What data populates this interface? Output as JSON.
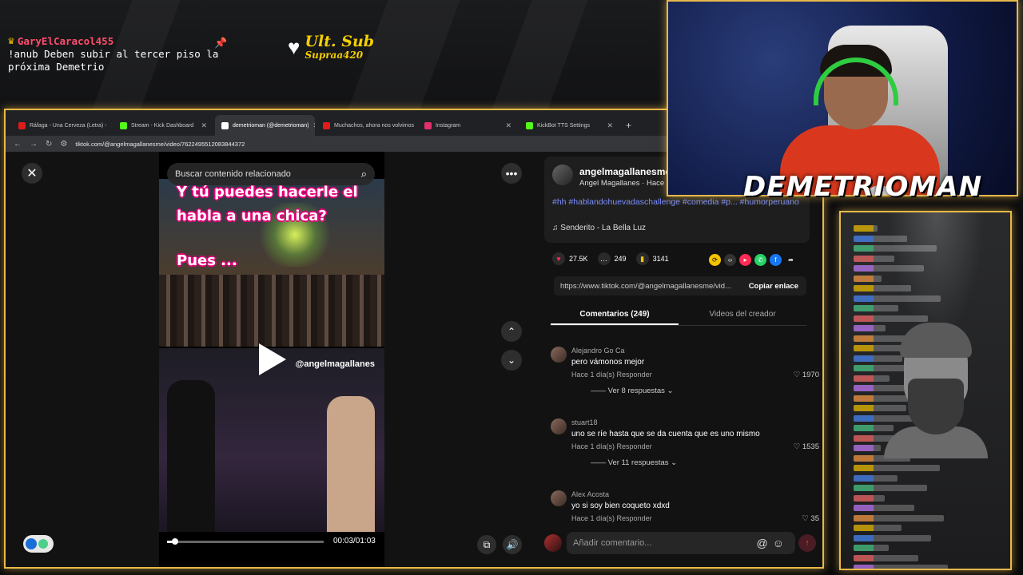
{
  "overlay": {
    "chat_user": "GaryElCaracol455",
    "chat_message": "!anub Deben subir al tercer piso la próxima Demetrio",
    "ult_sub_label": "Ult. Sub",
    "ult_sub_name": "Supraa420",
    "streamer_name": "DEMETRIOMAN"
  },
  "browser": {
    "tabs": [
      {
        "label": "Ráfaga - Una Cerveza (Letra) - ",
        "icon": "youtube-icon",
        "color": "#e01b1b",
        "active": false
      },
      {
        "label": "Stream - Kick Dashboard",
        "icon": "kick-icon",
        "color": "#53fc18",
        "active": false
      },
      {
        "label": "demetrioman (@demetrioman)",
        "icon": "tiktok-icon",
        "color": "#ffffff",
        "active": true
      },
      {
        "label": "Muchachos, ahora nos volvimos",
        "icon": "youtube-icon",
        "color": "#e01b1b",
        "active": false
      },
      {
        "label": "Instagram",
        "icon": "instagram-icon",
        "color": "#e1306c",
        "active": false
      },
      {
        "label": "KickBot TTS Settings",
        "icon": "kick-icon",
        "color": "#53fc18",
        "active": false
      }
    ],
    "url": "tiktok.com/@angelmagallanesme/video/7622495512083844372"
  },
  "video": {
    "search_placeholder": "Buscar contenido relacionado",
    "caption_line1": "Y tú puedes hacerle el",
    "caption_line2": "habla a una chica?",
    "caption_line3": "Pues ...",
    "handle": "@angelmagallanes",
    "time": "00:03/01:03",
    "progress": 0.05
  },
  "post": {
    "author": "angelmagallanesme",
    "author_sub": "Angel Magallanes · Hace",
    "hashtags": "#hh #hablandohuevadaschallenge #comedia #p... #humorperuano",
    "sound": "Senderito - La Bella Luz",
    "likes": "27.5K",
    "comments": "249",
    "saves": "3141",
    "link": "https://www.tiktok.com/@angelmagallanesme/vid...",
    "copy_label": "Copiar enlace"
  },
  "comment_tabs": [
    "Comentarios (249)",
    "Videos del creador"
  ],
  "comments": [
    {
      "user": "Alejandro Go Ca",
      "text": "pero vámonos mejor",
      "time": "Hace 1 día(s)",
      "reply": "Responder",
      "likes": "1970",
      "more": "Ver 8 respuestas"
    },
    {
      "user": "stuart18",
      "text": "uno se ríe hasta que se da cuenta que es uno mismo",
      "time": "Hace 1 día(s)",
      "reply": "Responder",
      "likes": "1535",
      "more": "Ver 11 respuestas"
    },
    {
      "user": "Alex Acosta",
      "text": "yo si soy bien coqueto xdxd",
      "time": "Hace 1 día(s)",
      "reply": "Responder",
      "likes": "35",
      "more": ""
    }
  ],
  "comment_input_placeholder": "Añadir comentario...",
  "colors": {
    "accent_border": "#e8b84a",
    "hashtag": "#7c8fff",
    "tiktok_red": "#fe2c55"
  }
}
